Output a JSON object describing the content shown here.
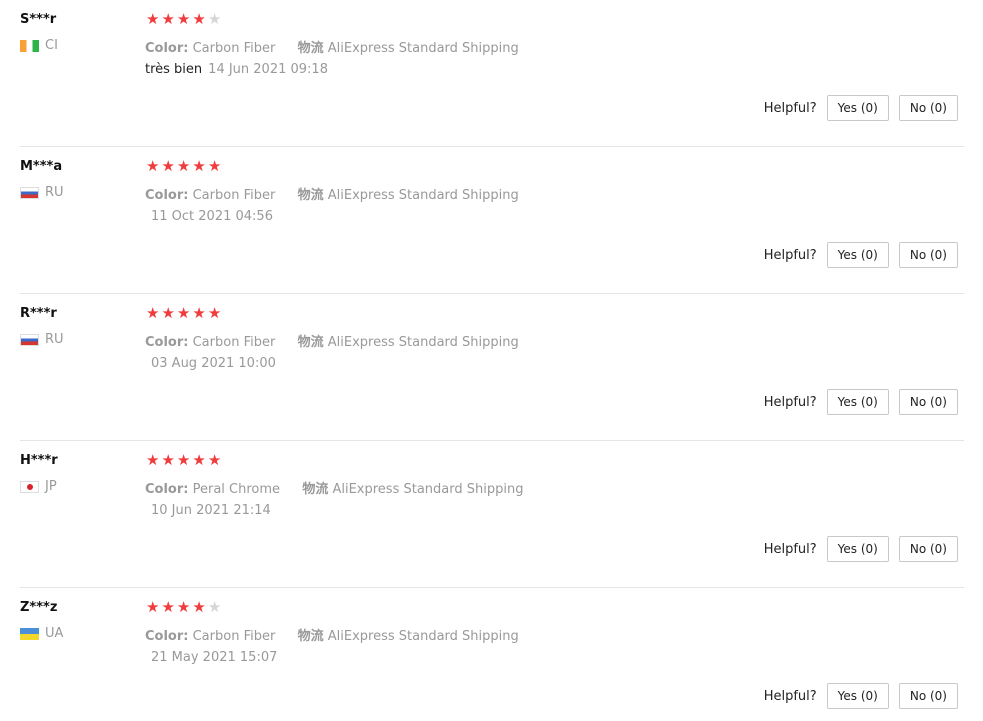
{
  "reviews": [
    {
      "user": "S***r",
      "country": "CI",
      "flag": "ci",
      "rating": 4,
      "color_label": "Color:",
      "color_value": "Carbon Fiber",
      "shipping_label": "物流",
      "shipping_value": "AliExpress Standard Shipping",
      "text": "très bien",
      "date": "14 Jun 2021 09:18",
      "helpful_label": "Helpful?",
      "yes_label": "Yes (0)",
      "no_label": "No (0)"
    },
    {
      "user": "M***a",
      "country": "RU",
      "flag": "ru",
      "rating": 5,
      "color_label": "Color:",
      "color_value": "Carbon Fiber",
      "shipping_label": "物流",
      "shipping_value": "AliExpress Standard Shipping",
      "text": "",
      "date": "11 Oct 2021 04:56",
      "helpful_label": "Helpful?",
      "yes_label": "Yes (0)",
      "no_label": "No (0)"
    },
    {
      "user": "R***r",
      "country": "RU",
      "flag": "ru",
      "rating": 5,
      "color_label": "Color:",
      "color_value": "Carbon Fiber",
      "shipping_label": "物流",
      "shipping_value": "AliExpress Standard Shipping",
      "text": "",
      "date": "03 Aug 2021 10:00",
      "helpful_label": "Helpful?",
      "yes_label": "Yes (0)",
      "no_label": "No (0)"
    },
    {
      "user": "H***r",
      "country": "JP",
      "flag": "jp",
      "rating": 5,
      "color_label": "Color:",
      "color_value": "Peral Chrome",
      "shipping_label": "物流",
      "shipping_value": "AliExpress Standard Shipping",
      "text": "",
      "date": "10 Jun 2021 21:14",
      "helpful_label": "Helpful?",
      "yes_label": "Yes (0)",
      "no_label": "No (0)"
    },
    {
      "user": "Z***z",
      "country": "UA",
      "flag": "ua",
      "rating": 4,
      "color_label": "Color:",
      "color_value": "Carbon Fiber",
      "shipping_label": "物流",
      "shipping_value": "AliExpress Standard Shipping",
      "text": "",
      "date": "21 May 2021 15:07",
      "helpful_label": "Helpful?",
      "yes_label": "Yes (0)",
      "no_label": "No (0)"
    }
  ],
  "colors": {
    "star_on": "#f03c3c",
    "star_off": "#d6d6d6",
    "muted_text": "#999999",
    "divider": "#e5e5e5"
  },
  "icons": {
    "star": "star-icon",
    "flag": "flag-icon"
  }
}
